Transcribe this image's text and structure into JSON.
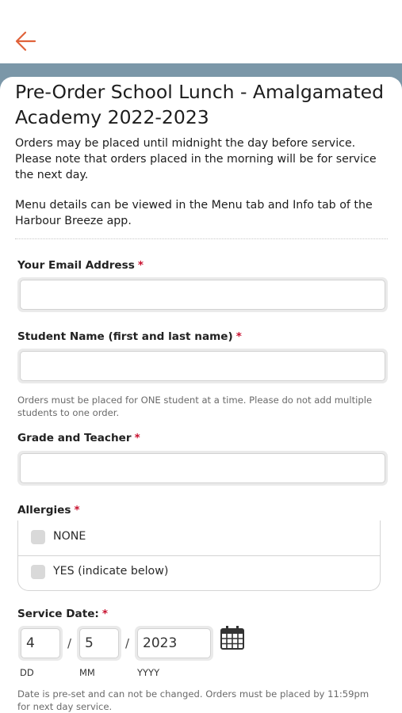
{
  "colors": {
    "accent": "#e0623a",
    "band": "#7b97a8",
    "required": "#c8102e"
  },
  "nav": {
    "back_icon": "arrow-left-icon"
  },
  "form": {
    "title": "Pre-Order School Lunch - Amalgamated Academy 2022-2023",
    "description_1": "Orders may be placed until midnight the day before service. Please note that orders placed in the morning will be for service the next day.",
    "description_2": "Menu details can be viewed in the Menu tab and Info tab of the Harbour Breeze app.",
    "required_mark": "*",
    "email": {
      "label": "Your Email Address",
      "value": ""
    },
    "student": {
      "label": "Student Name (first and last name)",
      "value": "",
      "hint": "Orders must be placed for ONE student at a time. Please do not add multiple students to one order."
    },
    "grade": {
      "label": "Grade and Teacher",
      "value": ""
    },
    "allergies": {
      "label": "Allergies",
      "options": [
        {
          "label": "NONE",
          "checked": false
        },
        {
          "label": "YES (indicate below)",
          "checked": false
        }
      ]
    },
    "service_date": {
      "label": "Service Date:",
      "day": "4",
      "month": "5",
      "year": "2023",
      "separator": "/",
      "day_label": "DD",
      "month_label": "MM",
      "year_label": "YYYY",
      "calendar_icon": "calendar-icon",
      "hint": "Date is pre-set and can not be changed. Orders must be placed by 11:59pm for next day service."
    }
  }
}
